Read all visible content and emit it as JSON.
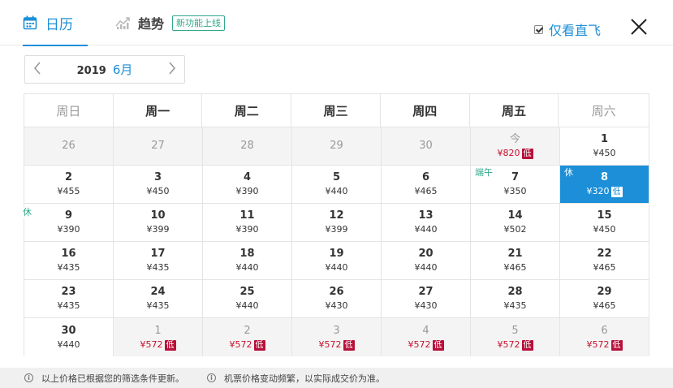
{
  "header": {
    "tabs": [
      {
        "label": "日历",
        "icon": "calendar-icon",
        "active": true
      },
      {
        "label": "趋势",
        "icon": "trend-chart-icon",
        "badge": "新功能上线"
      }
    ],
    "direct_only": {
      "label": "仅看直飞",
      "checked": true
    },
    "accent_color": "#1c8fd8"
  },
  "month_nav": {
    "year": "2019",
    "month": "6月"
  },
  "weekdays": [
    "周日",
    "周一",
    "周二",
    "周三",
    "周四",
    "周五",
    "周六"
  ],
  "low_label": "低",
  "weeks": [
    [
      {
        "day": "26",
        "price": "",
        "muted": true
      },
      {
        "day": "27",
        "price": "",
        "muted": true
      },
      {
        "day": "28",
        "price": "",
        "muted": true
      },
      {
        "day": "29",
        "price": "",
        "muted": true
      },
      {
        "day": "30",
        "price": "",
        "muted": true
      },
      {
        "day": "今",
        "price": "¥820",
        "low": true,
        "muted": true,
        "red": true
      },
      {
        "day": "1",
        "price": "¥450"
      }
    ],
    [
      {
        "day": "2",
        "price": "¥455"
      },
      {
        "day": "3",
        "price": "¥450"
      },
      {
        "day": "4",
        "price": "¥390"
      },
      {
        "day": "5",
        "price": "¥440"
      },
      {
        "day": "6",
        "price": "¥465"
      },
      {
        "day": "7",
        "price": "¥350",
        "tag": "端午"
      },
      {
        "day": "8",
        "price": "¥320",
        "low": true,
        "selected": true,
        "tag": "休"
      }
    ],
    [
      {
        "day": "9",
        "price": "¥390",
        "tag": "休",
        "tag_outside": true
      },
      {
        "day": "10",
        "price": "¥399"
      },
      {
        "day": "11",
        "price": "¥390"
      },
      {
        "day": "12",
        "price": "¥399"
      },
      {
        "day": "13",
        "price": "¥440"
      },
      {
        "day": "14",
        "price": "¥502"
      },
      {
        "day": "15",
        "price": "¥450"
      }
    ],
    [
      {
        "day": "16",
        "price": "¥435"
      },
      {
        "day": "17",
        "price": "¥435"
      },
      {
        "day": "18",
        "price": "¥440"
      },
      {
        "day": "19",
        "price": "¥440"
      },
      {
        "day": "20",
        "price": "¥440"
      },
      {
        "day": "21",
        "price": "¥465"
      },
      {
        "day": "22",
        "price": "¥465"
      }
    ],
    [
      {
        "day": "23",
        "price": "¥435"
      },
      {
        "day": "24",
        "price": "¥435"
      },
      {
        "day": "25",
        "price": "¥440"
      },
      {
        "day": "26",
        "price": "¥430"
      },
      {
        "day": "27",
        "price": "¥430"
      },
      {
        "day": "28",
        "price": "¥435"
      },
      {
        "day": "29",
        "price": "¥465"
      }
    ],
    [
      {
        "day": "30",
        "price": "¥440"
      },
      {
        "day": "1",
        "price": "¥572",
        "low": true,
        "muted": true,
        "red": true
      },
      {
        "day": "2",
        "price": "¥572",
        "low": true,
        "muted": true,
        "red": true
      },
      {
        "day": "3",
        "price": "¥572",
        "low": true,
        "muted": true,
        "red": true
      },
      {
        "day": "4",
        "price": "¥572",
        "low": true,
        "muted": true,
        "red": true
      },
      {
        "day": "5",
        "price": "¥572",
        "low": true,
        "muted": true,
        "red": true
      },
      {
        "day": "6",
        "price": "¥572",
        "low": true,
        "muted": true,
        "red": true
      }
    ]
  ],
  "footer_notes": [
    "以上价格已根据您的筛选条件更新。",
    "机票价格变动频繁，以实际成交价为准。"
  ]
}
